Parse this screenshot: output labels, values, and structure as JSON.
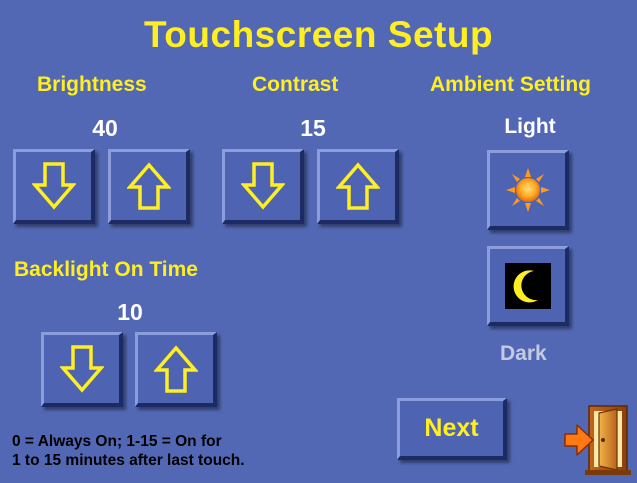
{
  "title": "Touchscreen Setup",
  "brightness": {
    "label": "Brightness",
    "value": "40"
  },
  "contrast": {
    "label": "Contrast",
    "value": "15"
  },
  "ambient": {
    "label": "Ambient Setting",
    "light_label": "Light",
    "dark_label": "Dark"
  },
  "backlight": {
    "label": "Backlight On Time",
    "value": "10",
    "note_line1": "0 = Always On; 1-15 = On for",
    "note_line2": "1 to 15 minutes after last touch."
  },
  "next_label": "Next",
  "icons": {
    "down": "arrow-down-icon",
    "up": "arrow-up-icon",
    "light": "sun-icon",
    "dark": "moon-icon",
    "exit": "exit-door-icon"
  },
  "colors": {
    "background": "#5268b4",
    "heading": "#ffee22",
    "value": "#ffffff",
    "arrow_outline": "#ffee22"
  }
}
